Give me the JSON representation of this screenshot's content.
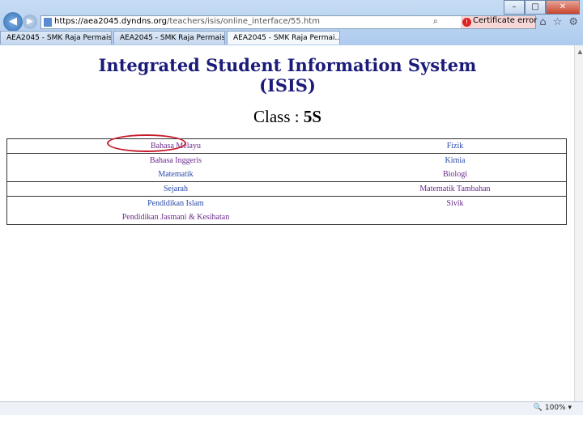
{
  "browser": {
    "url_host": "https://aea2045.dyndns.org",
    "url_path": "/teachers/isis/online_interface/55.htm",
    "search_icon": "⌕",
    "cert_error": "Certificate error",
    "tabs": [
      {
        "label": "AEA2045 - SMK Raja Permaisur...",
        "active": false
      },
      {
        "label": "AEA2045 - SMK Raja Permaisur...",
        "active": false
      },
      {
        "label": "AEA2045 - SMK Raja Permai...",
        "active": true
      }
    ],
    "zoom": "100%"
  },
  "page": {
    "title_line1": "Integrated Student Information System",
    "title_line2": "(ISIS)",
    "class_label": "Class : ",
    "class_value": "5S"
  },
  "subjects": {
    "rows": [
      {
        "left": "Bahasa Melayu",
        "right": "Fizik"
      },
      {
        "left": "Bahasa Inggeris",
        "right": "Kimia"
      },
      {
        "left": "Matematik",
        "right": "Biologi"
      },
      {
        "left": "Sejarah",
        "right": "Matematik Tambahan"
      },
      {
        "left": "Pendidikan Islam",
        "right": "Sivik"
      },
      {
        "left": "Pendidikan Jasmani & Kesihatan",
        "right": ""
      }
    ]
  },
  "colors": {
    "title": "#1b1b7a",
    "highlight": "#c8192a"
  }
}
